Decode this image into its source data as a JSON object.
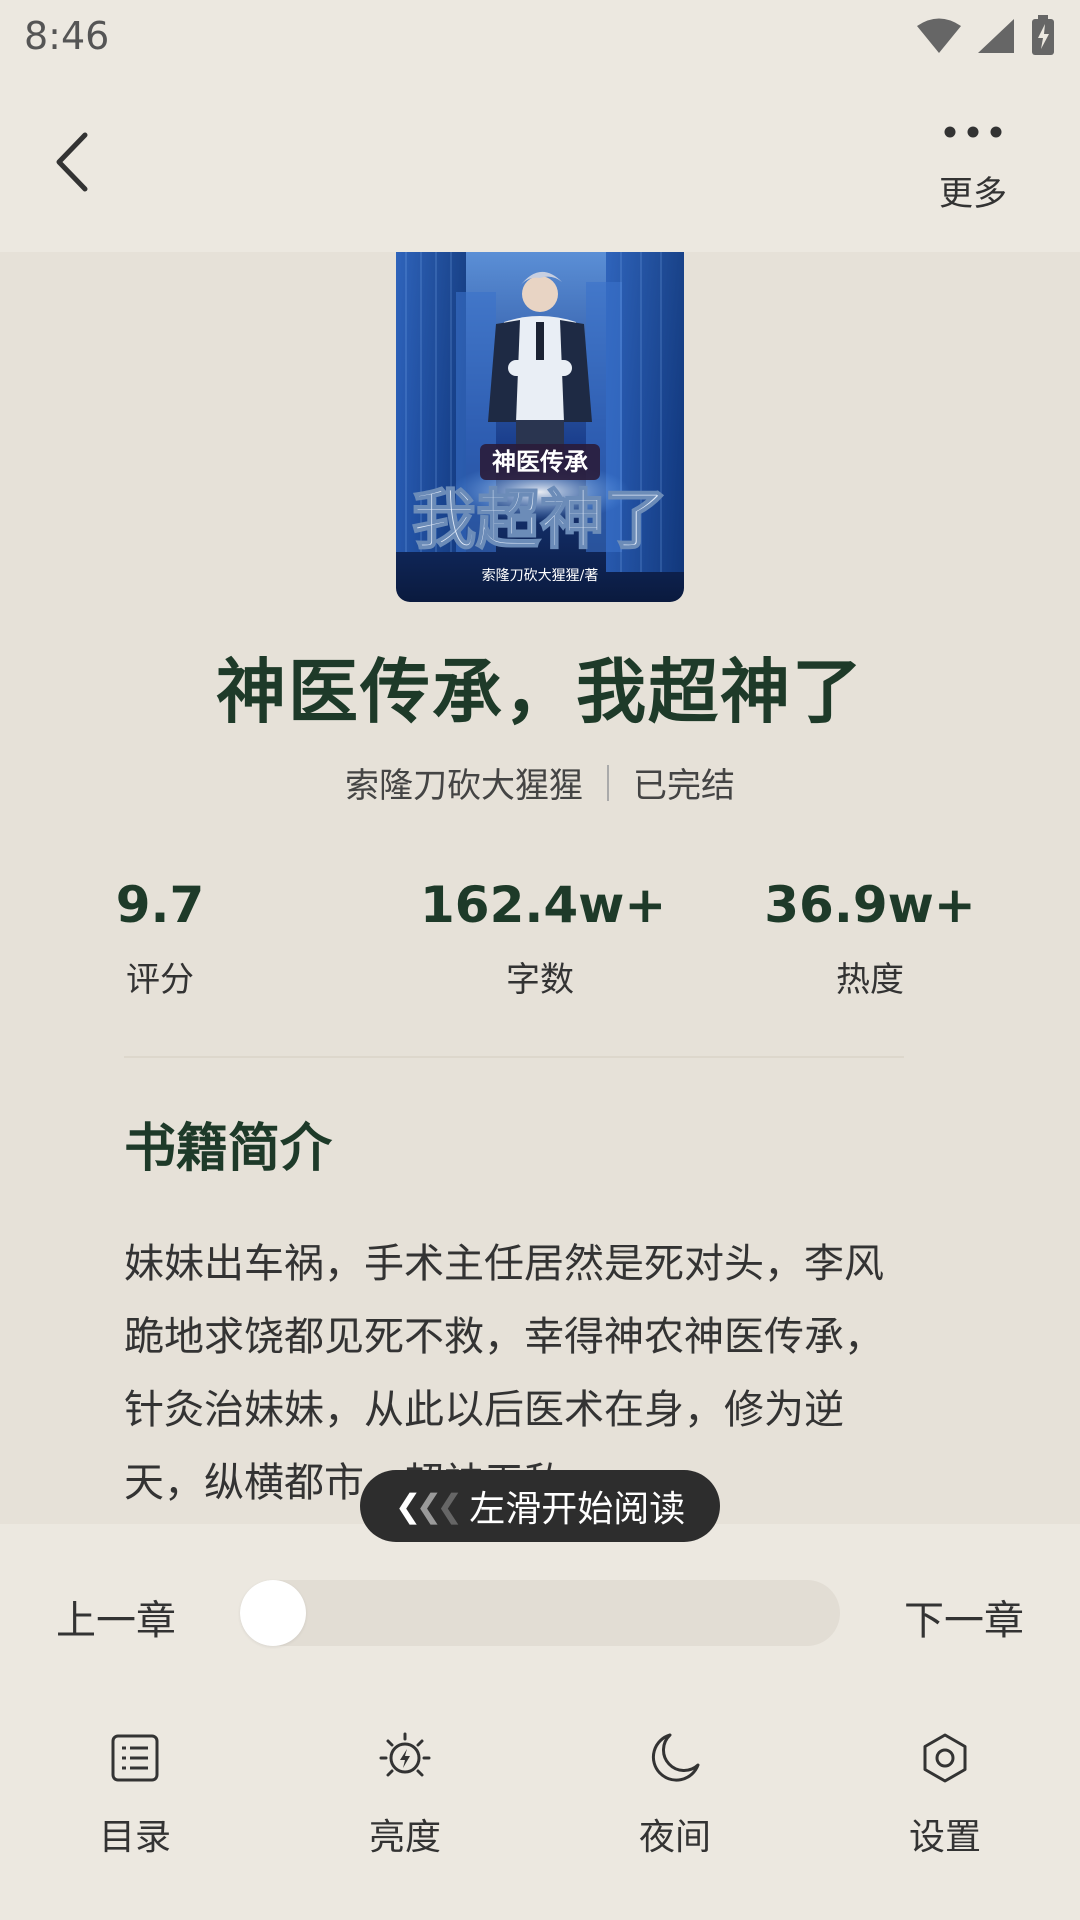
{
  "status_bar": {
    "time": "8:46"
  },
  "header": {
    "more_label": "更多"
  },
  "book": {
    "cover_series": "神医传承",
    "cover_title": "我超神了",
    "cover_author": "索隆刀砍大猩猩/著",
    "title": "神医传承，我超神了",
    "author": "索隆刀砍大猩猩",
    "status": "已完结",
    "stats": [
      {
        "value": "9.7",
        "label": "评分"
      },
      {
        "value": "162.4w+",
        "label": "字数"
      },
      {
        "value": "36.9w+",
        "label": "热度"
      }
    ],
    "intro_heading": "书籍简介",
    "intro_text": "妹妹出车祸，手术主任居然是死对头，李风跪地求饶都见死不救，幸得神农神医传承，针灸治妹妹，从此以后医术在身，修为逆天，纵横都市，超神无敌。"
  },
  "swipe_hint": "左滑开始阅读",
  "reader": {
    "prev_chapter": "上一章",
    "next_chapter": "下一章",
    "progress": 0
  },
  "bottom_nav": [
    {
      "label": "目录",
      "icon": "list-icon"
    },
    {
      "label": "亮度",
      "icon": "brightness-icon"
    },
    {
      "label": "夜间",
      "icon": "moon-icon"
    },
    {
      "label": "设置",
      "icon": "settings-icon"
    }
  ],
  "colors": {
    "background": "#e6e1d8",
    "panel": "#ece8e0",
    "title_green": "#1e3a29",
    "hint_bg": "#2d2d2d"
  }
}
